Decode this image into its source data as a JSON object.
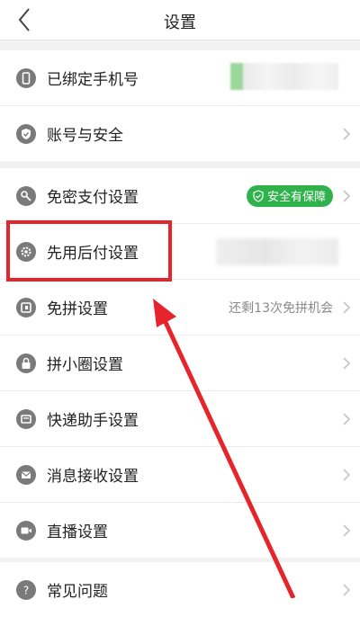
{
  "header": {
    "title": "设置"
  },
  "group1": [
    {
      "label": "已绑定手机号",
      "icon": "phone-icon"
    },
    {
      "label": "账号与安全",
      "icon": "shield-icon"
    }
  ],
  "group2": [
    {
      "label": "免密支付设置",
      "icon": "key-icon",
      "badge": "安全有保障"
    },
    {
      "label": "先用后付设置",
      "icon": "gear-icon"
    },
    {
      "label": "免拼设置",
      "icon": "ticket-icon",
      "right_text": "还剩13次免拼机会"
    },
    {
      "label": "拼小圈设置",
      "icon": "lock-icon"
    },
    {
      "label": "快递助手设置",
      "icon": "delivery-icon"
    },
    {
      "label": "消息接收设置",
      "icon": "message-icon"
    },
    {
      "label": "直播设置",
      "icon": "video-icon"
    }
  ],
  "group3": [
    {
      "label": "常见问题",
      "icon": "question-icon"
    }
  ],
  "colors": {
    "badge": "#2fb24c",
    "highlight": "#e5242b",
    "icon": "#7a7a7a"
  }
}
